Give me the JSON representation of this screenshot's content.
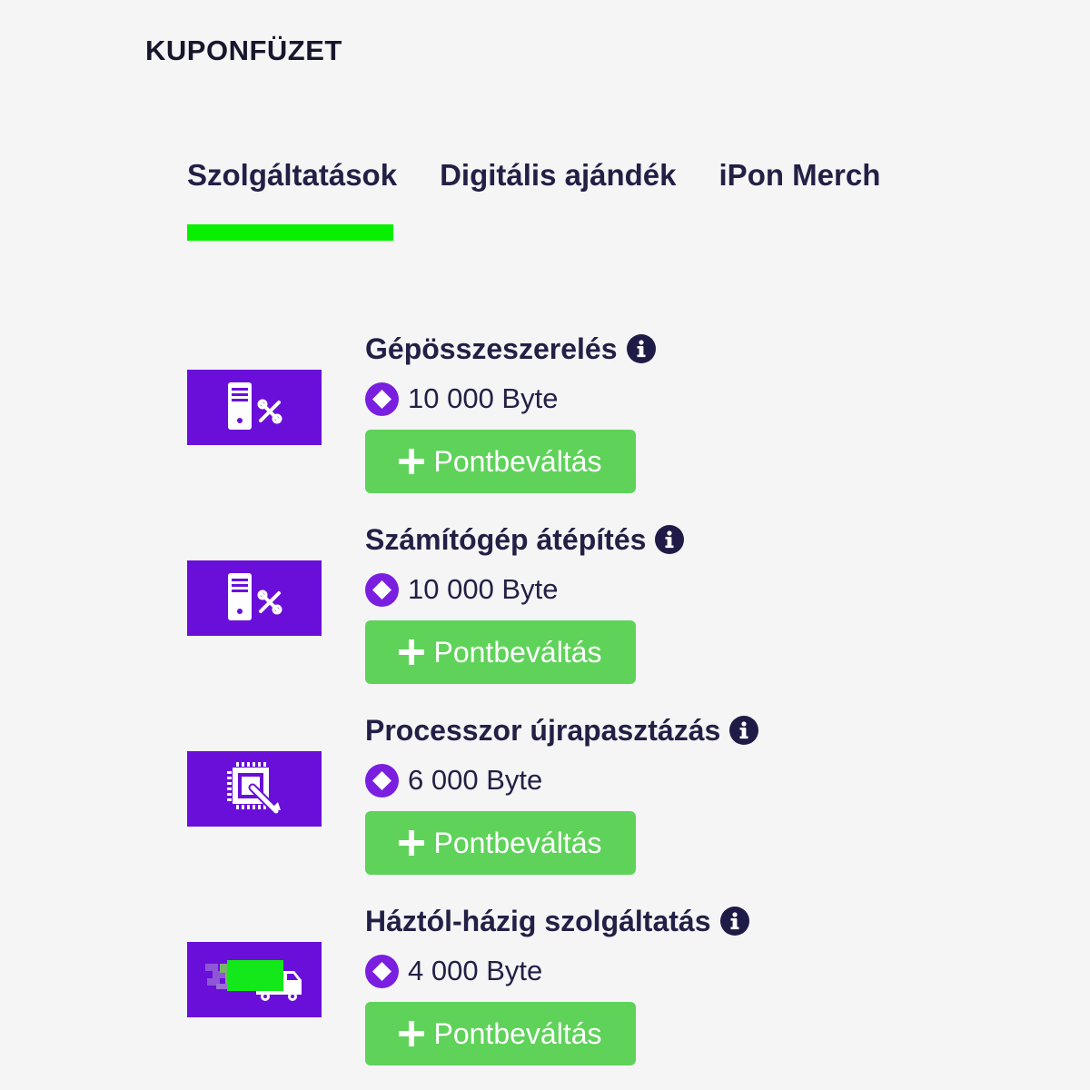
{
  "page": {
    "title": "KUPONFÜZET"
  },
  "tabs": [
    {
      "label": "Szolgáltatások",
      "active": true
    },
    {
      "label": "Digitális ajándék",
      "active": false
    },
    {
      "label": "iPon Merch",
      "active": false
    }
  ],
  "colors": {
    "accent_green": "#08f000",
    "icon_background": "#6a0fd9",
    "button_green": "#5fd25a",
    "byte_purple": "#7a1fe0",
    "text_dark": "#232046"
  },
  "services": [
    {
      "name": "Gépösszeszerelés",
      "price": "10 000 Byte",
      "button_label": "Pontbeváltás",
      "icon": "pc-tools-icon"
    },
    {
      "name": "Számítógép átépítés",
      "price": "10 000 Byte",
      "button_label": "Pontbeváltás",
      "icon": "pc-tools-icon"
    },
    {
      "name": "Processzor újrapasztázás",
      "price": "6 000 Byte",
      "button_label": "Pontbeváltás",
      "icon": "cpu-paste-icon"
    },
    {
      "name": "Háztól-házig szolgáltatás",
      "price": "4 000 Byte",
      "button_label": "Pontbeváltás",
      "icon": "delivery-truck-icon"
    }
  ]
}
